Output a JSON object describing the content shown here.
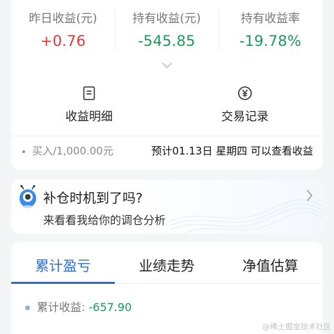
{
  "summary": {
    "stats": [
      {
        "label": "昨日收益(元)",
        "value": "+0.76"
      },
      {
        "label": "持有收益(元)",
        "value": "-545.85"
      },
      {
        "label": "持有收益率",
        "value": "-19.78%"
      }
    ],
    "actions": [
      {
        "label": "收益明细",
        "icon": "document-icon"
      },
      {
        "label": "交易记录",
        "icon": "yen-coin-icon"
      }
    ],
    "buy_info": "买入/1,000.00元",
    "notice": "预计01.13日 星期四 可以查看收益"
  },
  "promo": {
    "title": "补仓时机到了吗?",
    "subtitle": "来看看我给你的调仓分析"
  },
  "tabs": {
    "items": [
      "累计盈亏",
      "业绩走势",
      "净值估算"
    ],
    "active_index": 0
  },
  "chart_legend": {
    "label": "累计收益: ",
    "value": "-657.90"
  },
  "watermark": "@稀土掘金技术社区",
  "colors": {
    "gain": "#e0363a",
    "loss": "#1a9b5c",
    "accent": "#2a6fd6"
  }
}
